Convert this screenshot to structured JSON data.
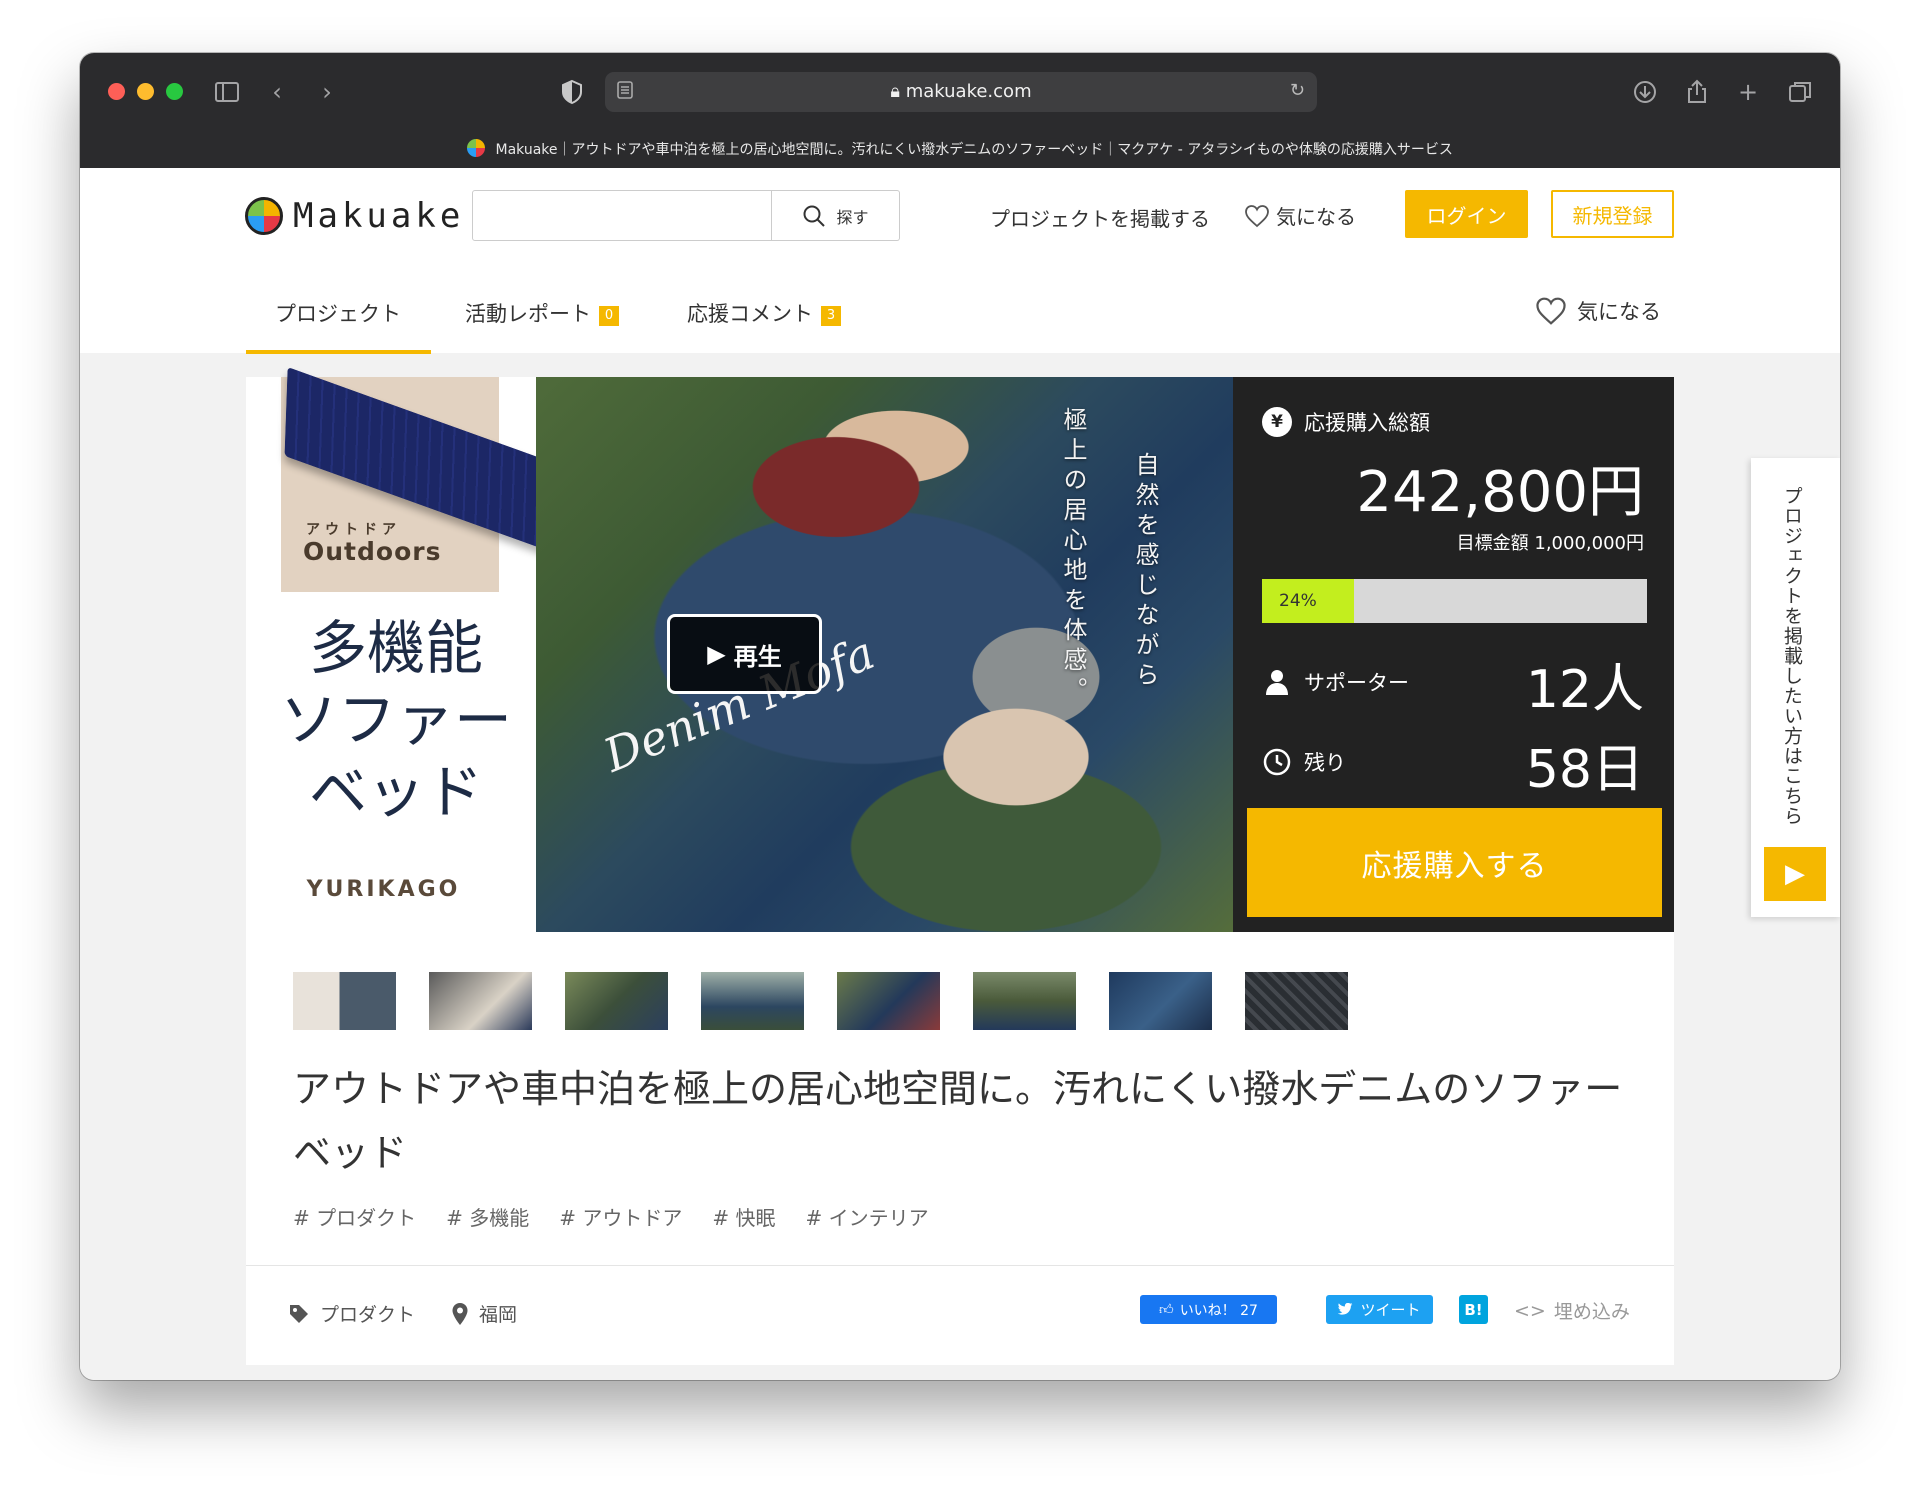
{
  "browser": {
    "url": "makuake.com",
    "tab_title": "Makuake｜アウトドアや車中泊を極上の居心地空間に。汚れにくい撥水デニムのソファーベッド｜マクアケ - アタラシイものや体験の応援購入サービス"
  },
  "header": {
    "logo_text": "Makuake",
    "search_button": "探す",
    "post_project": "プロジェクトを掲載する",
    "favorite": "気になる",
    "login": "ログイン",
    "signup": "新規登録"
  },
  "tabs": [
    {
      "label": "プロジェクト"
    },
    {
      "label": "活動レポート",
      "badge": "0"
    },
    {
      "label": "応援コメント",
      "badge": "3"
    }
  ],
  "tab_favorite": "気になる",
  "hero": {
    "outdoor_kana": "アウトドア",
    "outdoor_en": "Outdoors",
    "title_lines": [
      "多機能",
      "ソファー",
      "ベッド"
    ],
    "brand": "YURIKAGO",
    "vertical_text_1": "極上の居心地を体感。",
    "vertical_text_2": "自然を感じながら",
    "script_text": "Denim Mofa",
    "play_label": "再生"
  },
  "stats": {
    "total_label": "応援購入総額",
    "total_amount": "242,800円",
    "goal_text": "目標金額 1,000,000円",
    "progress_percent": 24,
    "progress_label": "24%",
    "supporters_label": "サポーター",
    "supporters_value": "12人",
    "remaining_label": "残り",
    "remaining_value": "58日",
    "buy_button": "応援購入する"
  },
  "side_tab": {
    "text": "プロジェクトを掲載したい方はこちら"
  },
  "project": {
    "title": "アウトドアや車中泊を極上の居心地空間に。汚れにくい撥水デニムのソファーベッド",
    "tags": [
      "# プロダクト",
      "# 多機能",
      "# アウトドア",
      "# 快眠",
      "# インテリア"
    ],
    "category": "プロダクト",
    "location": "福岡",
    "fb_like": "いいね！ 27",
    "tweet": "ツイート",
    "hatena": "B!",
    "embed": "埋め込み"
  },
  "colors": {
    "accent": "#f5b800",
    "progress_fill": "#c3ee1e",
    "stats_bg": "#222222",
    "facebook": "#1877f2",
    "twitter": "#1da1f2",
    "hatena": "#00a4de"
  }
}
